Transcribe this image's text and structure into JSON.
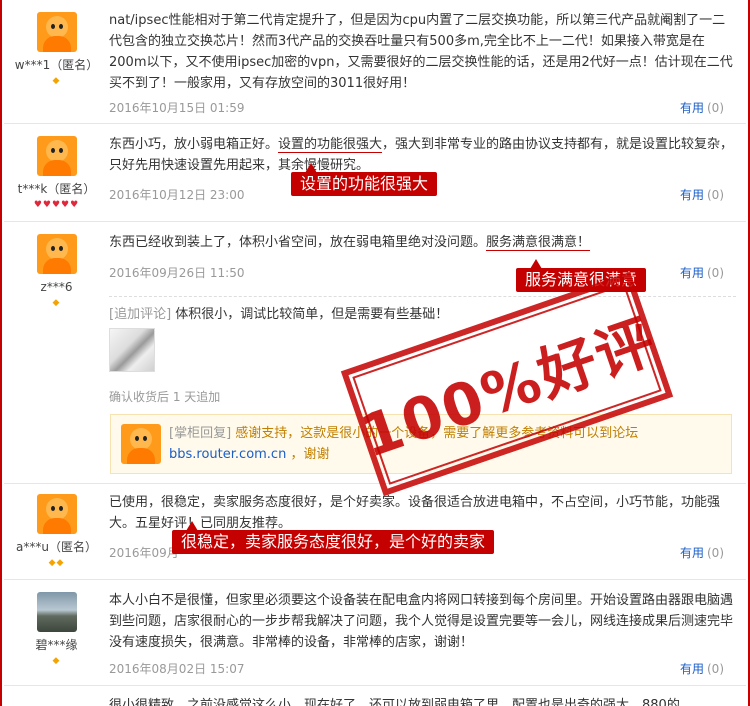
{
  "reviews": [
    {
      "username": "w***1（匿名）",
      "level": "◆",
      "text": "nat/ipsec性能相对于第二代肯定提升了，但是因为cpu内置了二层交换功能，所以第三代产品就阉割了一二代包含的独立交换芯片！然而3代产品的交换吞吐量只有500多m,完全比不上一二代！如果接入带宽是在200m以下，又不使用ipsec加密的vpn，又需要很好的二层交换性能的话，还是用2代好一点！估计现在二代买不到了！一般家用，又有存放空间的3011很好用！",
      "date": "2016年10月15日 01:59",
      "useful_label": "有用",
      "useful_count": "(0)"
    },
    {
      "username": "t***k（匿名）",
      "level": "♥♥♥♥♥",
      "text_before": "东西小巧，放小弱电箱正好。",
      "text_highlight": "设置的功能很强大",
      "text_after": "，强大到非常专业的路由协议支持都有，就是设置比较复杂，只好先用快速设置先用起来，其余慢慢研究。",
      "date": "2016年10月12日 23:00",
      "callout": "设置的功能很强大",
      "useful_label": "有用",
      "useful_count": "(0)"
    },
    {
      "username": "z***6",
      "level": "◆",
      "text_before": "东西已经收到装上了，体积小省空间，放在弱电箱里绝对没问题。",
      "text_highlight": "服务满意很满意！",
      "date": "2016年09月26日 11:50",
      "callout": "服务满意很满意",
      "useful_label": "有用",
      "useful_count": "(0)",
      "append_label": "[追加评论]",
      "append_text": " 体积很小，调试比较简单，但是需要有些基础！",
      "append_date": "确认收货后 1 天追加",
      "reply_label": "[掌柜回复]",
      "reply_text": " 感谢支持，这款是很小的一个设备，需要了解更多参考资料可以到论坛",
      "reply_link": "bbs.router.com.cn",
      "reply_tail": " ，谢谢"
    },
    {
      "username": "a***u（匿名）",
      "level": "◆◆",
      "text_before": "已使用，很稳定，卖家服务态度很好，是个好卖家。设备很适合放进电箱中，不占空间，小巧节能，功能强大。五星好评！已同朋友推荐。",
      "date": "2016年09月",
      "callout": "很稳定，卖家服务态度很好，是个好的卖家",
      "useful_label": "有用",
      "useful_count": "(0)"
    },
    {
      "username": "碧***缘",
      "level": "◆",
      "text": "本人小白不是很懂，但家里必须要这个设备装在配电盒内将网口转接到每个房间里。开始设置路由器跟电脑遇到些问题，店家很耐心的一步步帮我解决了问题，我个人觉得是设置完要等一会儿，网线连接成果后测速完毕没有速度损失，很满意。非常棒的设备，非常棒的店家，谢谢！",
      "date": "2016年08月02日 15:07",
      "useful_label": "有用",
      "useful_count": "(0)"
    },
    {
      "text": "很小很精致，之前没感觉这么小，现在好了，还可以放到弱电箱了里，配置也是出奇的强大，880的"
    }
  ],
  "stamp_text": "100%好评",
  "colors": {
    "accent": "#c40000",
    "link": "#1a5ec6",
    "reply_bg": "#fffaeb"
  }
}
